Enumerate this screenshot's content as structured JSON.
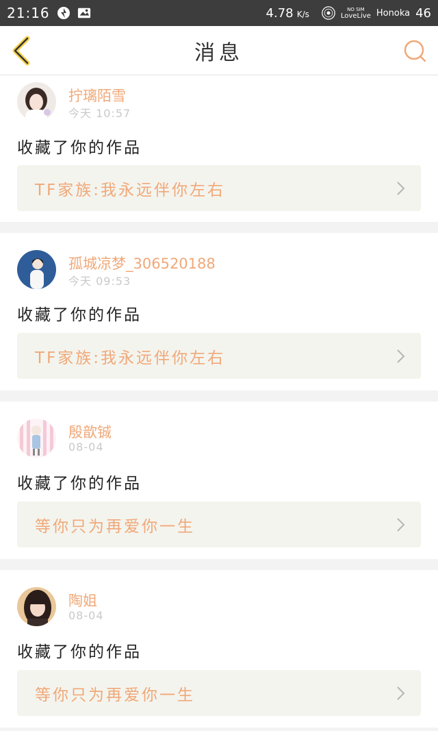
{
  "status_bar": {
    "time": "21:16",
    "speed": "4.78",
    "speed_unit": "K/s",
    "sim_text": "NO SIM",
    "carrier": "LoveLive",
    "operator": "Honoka",
    "signal": "46"
  },
  "header": {
    "title": "消息"
  },
  "messages": [
    {
      "username": "拧璃陌雪",
      "time": "今天 10:57",
      "action": "收藏了你的作品",
      "work": "TF家族:我永远伴你左右"
    },
    {
      "username": "孤城凉梦_306520188",
      "time": "今天 09:53",
      "action": "收藏了你的作品",
      "work": "TF家族:我永远伴你左右"
    },
    {
      "username": "殷歆铖",
      "time": "08-04",
      "action": "收藏了你的作品",
      "work": "等你只为再爱你一生"
    },
    {
      "username": "陶姐",
      "time": "08-04",
      "action": "收藏了你的作品",
      "work": "等你只为再爱你一生"
    }
  ],
  "colors": {
    "accent": "#f0a878",
    "status_bar_bg": "#3d3d3d",
    "work_bg": "#f4f4ee"
  }
}
